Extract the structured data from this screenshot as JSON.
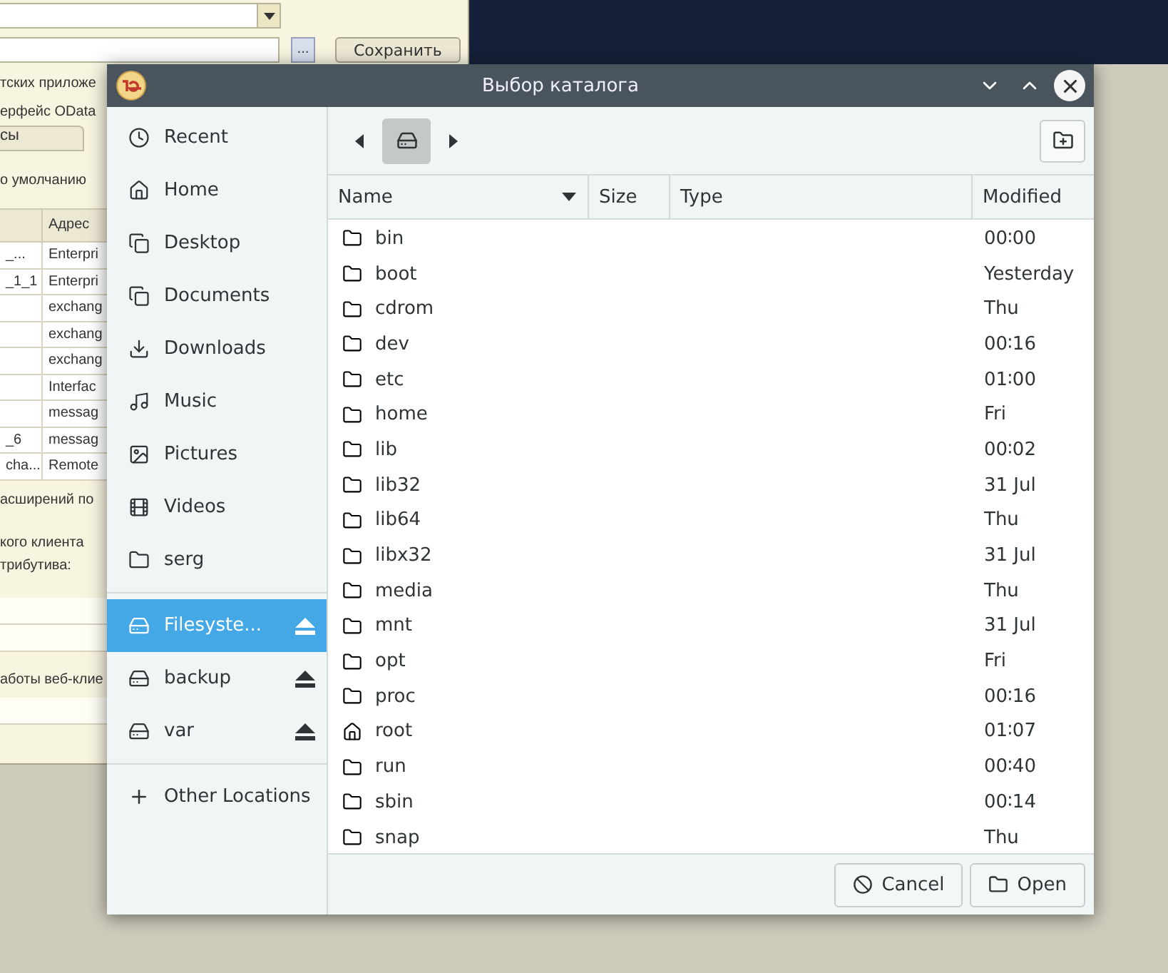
{
  "background_window": {
    "browse_button": "...",
    "save_button": "Сохранить",
    "lines_top": [
      "тских приложе",
      "ерфейс OData"
    ],
    "tab": "сы",
    "default_text": "о умолчанию",
    "table": {
      "column_2": "Адрес",
      "rows": [
        [
          "_...",
          "Enterpri"
        ],
        [
          "_1_1",
          "Enterpri"
        ],
        [
          "",
          "exchang"
        ],
        [
          "",
          "exchang"
        ],
        [
          "",
          "exchang"
        ],
        [
          "",
          "Interfac"
        ],
        [
          "",
          "messag"
        ],
        [
          "_6",
          "messag"
        ],
        [
          "cha...",
          "Remote"
        ]
      ]
    },
    "lines_bottom": [
      "асширений по",
      "кого клиента",
      "трибутива:"
    ],
    "last_line": "аботы веб-клие"
  },
  "dialog": {
    "title": "Выбор каталога",
    "places": [
      {
        "label": "Recent",
        "kind": "recent",
        "selected": false
      },
      {
        "label": "Home",
        "kind": "home",
        "selected": false
      },
      {
        "label": "Desktop",
        "kind": "doc",
        "selected": false
      },
      {
        "label": "Documents",
        "kind": "doc",
        "selected": false
      },
      {
        "label": "Downloads",
        "kind": "download",
        "selected": false
      },
      {
        "label": "Music",
        "kind": "music",
        "selected": false
      },
      {
        "label": "Pictures",
        "kind": "picture",
        "selected": false
      },
      {
        "label": "Videos",
        "kind": "video",
        "selected": false
      },
      {
        "label": "serg",
        "kind": "folder",
        "selected": false
      }
    ],
    "devices": [
      {
        "label": "Filesyste...",
        "selected": true
      },
      {
        "label": "backup",
        "selected": false
      },
      {
        "label": "var",
        "selected": false
      }
    ],
    "other_locations": "Other Locations",
    "columns": [
      "Name",
      "Size",
      "Type",
      "Modified"
    ],
    "files": [
      {
        "name": "bin",
        "kind": "folder",
        "modified": "00∶00"
      },
      {
        "name": "boot",
        "kind": "folder",
        "modified": "Yesterday"
      },
      {
        "name": "cdrom",
        "kind": "folder",
        "modified": "Thu"
      },
      {
        "name": "dev",
        "kind": "folder",
        "modified": "00∶16"
      },
      {
        "name": "etc",
        "kind": "folder",
        "modified": "01∶00"
      },
      {
        "name": "home",
        "kind": "folder",
        "modified": "Fri"
      },
      {
        "name": "lib",
        "kind": "folder",
        "modified": "00∶02"
      },
      {
        "name": "lib32",
        "kind": "folder",
        "modified": "31 Jul"
      },
      {
        "name": "lib64",
        "kind": "folder",
        "modified": "Thu"
      },
      {
        "name": "libx32",
        "kind": "folder",
        "modified": "31 Jul"
      },
      {
        "name": "media",
        "kind": "folder",
        "modified": "Thu"
      },
      {
        "name": "mnt",
        "kind": "folder",
        "modified": "31 Jul"
      },
      {
        "name": "opt",
        "kind": "folder",
        "modified": "Fri"
      },
      {
        "name": "proc",
        "kind": "folder",
        "modified": "00∶16"
      },
      {
        "name": "root",
        "kind": "home",
        "modified": "01∶07"
      },
      {
        "name": "run",
        "kind": "folder",
        "modified": "00∶40"
      },
      {
        "name": "sbin",
        "kind": "folder",
        "modified": "00∶14"
      },
      {
        "name": "snap",
        "kind": "folder",
        "modified": "Thu"
      }
    ],
    "buttons": [
      {
        "label": "Cancel",
        "kind": "cancel"
      },
      {
        "label": "Open",
        "kind": "open"
      }
    ]
  }
}
